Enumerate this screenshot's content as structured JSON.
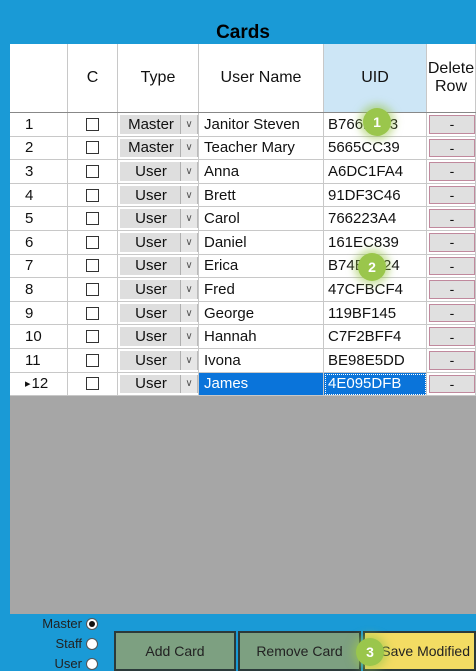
{
  "window": {
    "title": "Cards"
  },
  "columns": {
    "num": "",
    "check": "C",
    "type": "Type",
    "name": "User Name",
    "uid": "UID",
    "delete": "Delete Row"
  },
  "rows": [
    {
      "num": "1",
      "checked": false,
      "type": "Master",
      "name": "Janitor Steven",
      "uid": "B766B763",
      "delete": "-"
    },
    {
      "num": "2",
      "checked": false,
      "type": "Master",
      "name": "Teacher Mary",
      "uid": "5665CC39",
      "delete": "-"
    },
    {
      "num": "3",
      "checked": false,
      "type": "User",
      "name": "Anna",
      "uid": "A6DC1FA4",
      "delete": "-"
    },
    {
      "num": "4",
      "checked": false,
      "type": "User",
      "name": "Brett",
      "uid": "91DF3C46",
      "delete": "-"
    },
    {
      "num": "5",
      "checked": false,
      "type": "User",
      "name": "Carol",
      "uid": "766223A4",
      "delete": "-"
    },
    {
      "num": "6",
      "checked": false,
      "type": "User",
      "name": "Daniel",
      "uid": "161EC839",
      "delete": "-"
    },
    {
      "num": "7",
      "checked": false,
      "type": "User",
      "name": "Erica",
      "uid": "B74EB224",
      "delete": "-"
    },
    {
      "num": "8",
      "checked": false,
      "type": "User",
      "name": "Fred",
      "uid": "47CFBCF4",
      "delete": "-"
    },
    {
      "num": "9",
      "checked": false,
      "type": "User",
      "name": "George",
      "uid": "119BF145",
      "delete": "-"
    },
    {
      "num": "10",
      "checked": false,
      "type": "User",
      "name": "Hannah",
      "uid": "C7F2BFF4",
      "delete": "-"
    },
    {
      "num": "11",
      "checked": false,
      "type": "User",
      "name": "Ivona",
      "uid": "BE98E5DD",
      "delete": "-"
    },
    {
      "num": "12",
      "checked": false,
      "type": "User",
      "name": "James",
      "uid": "4E095DFB",
      "delete": "-",
      "selected": true
    }
  ],
  "row_pointer": "▸",
  "badges": [
    "1",
    "2",
    "3"
  ],
  "radios": [
    {
      "label": "Master",
      "selected": true
    },
    {
      "label": "Staff",
      "selected": false
    },
    {
      "label": "User",
      "selected": false
    }
  ],
  "buttons": {
    "add_card": "Add Card",
    "remove_card": "Remove Card",
    "save_modified": "Save Modified"
  },
  "colors": {
    "accent_blue": "#1a9ad6",
    "selection_blue": "#0a74da",
    "badge_green": "#9ac64c",
    "button_green": "#7da081",
    "button_yellow": "#f3dc63"
  },
  "icons": {
    "dropdown": "chevron-down-icon",
    "row_pointer": "row-pointer-icon"
  }
}
